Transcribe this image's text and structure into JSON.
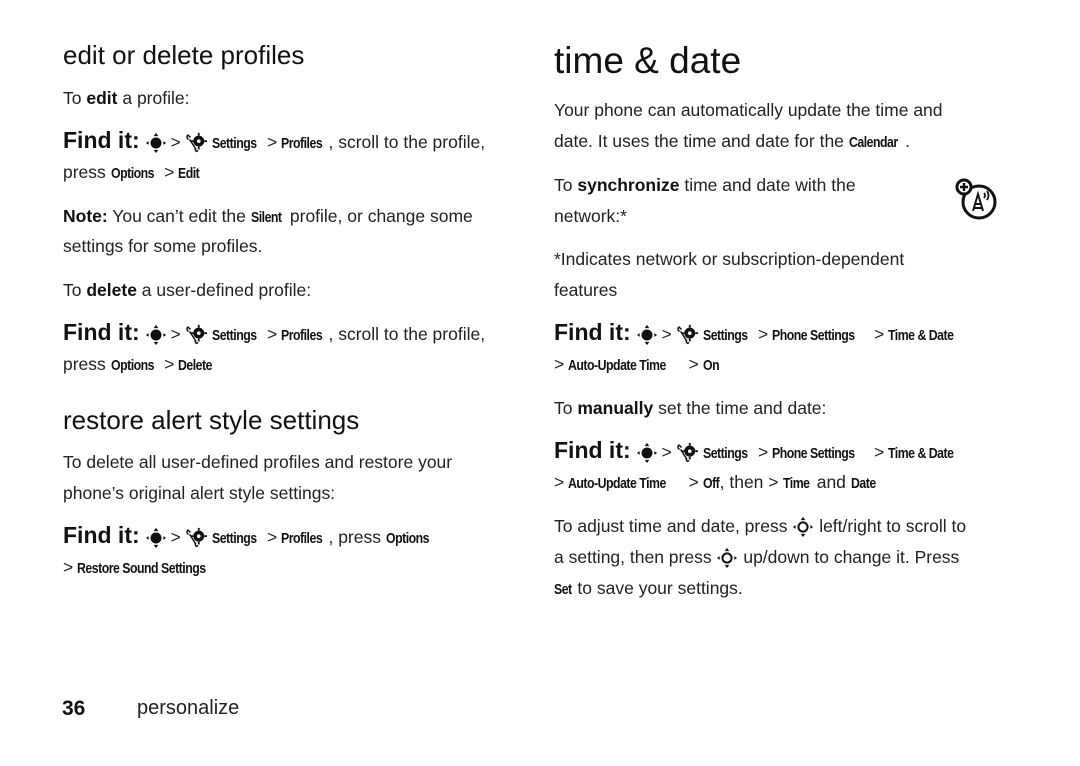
{
  "left": {
    "edit_heading": "edit or delete profiles",
    "edit_intro": {
      "pre": "To ",
      "bold": "edit",
      "post": " a profile:"
    },
    "find_label": "Find it:",
    "find_edit": {
      "settings": "Settings",
      "profiles": "Profiles",
      "tail": ", scroll to the profile,",
      "press": "press ",
      "options": "Options",
      "action": "Edit"
    },
    "note": {
      "label": "Note:",
      "text1": " You can’t edit the ",
      "silent": "Silent",
      "text2": " profile, or change some",
      "line2": "settings for some profiles."
    },
    "delete_intro": {
      "pre": "To ",
      "bold": "delete",
      "post": " a user-defined profile:"
    },
    "find_delete": {
      "settings": "Settings",
      "profiles": "Profiles",
      "tail": ", scroll to the profile,",
      "press": "press ",
      "options": "Options",
      "action": "Delete"
    },
    "restore_heading": "restore alert style settings",
    "restore_text_1": "To delete all user-defined profiles and restore your",
    "restore_text_2": "phone’s original alert style settings:",
    "find_restore": {
      "settings": "Settings",
      "profiles": "Profiles",
      "press": ", press ",
      "options": "Options",
      "action": "Restore Sound Settings"
    }
  },
  "right": {
    "heading": "time & date",
    "intro_1": "Your phone can automatically update the time and",
    "intro_2_pre": "date. It uses the time and date for the ",
    "intro_2_calendar": "Calendar",
    "intro_2_post": ".",
    "sync": {
      "pre": "To ",
      "bold": "synchronize",
      "post": " time and date with the",
      "line2": "network:*"
    },
    "footnote_1": "*Indicates network or subscription-dependent",
    "footnote_2": "features",
    "find_label": "Find it:",
    "find_sync": {
      "settings": "Settings",
      "phone_settings": "Phone Settings",
      "time_date": "Time & Date",
      "auto_update": "Auto-Update Time",
      "value": "On"
    },
    "manual": {
      "pre": "To ",
      "bold": "manually",
      "post": " set the time and date:"
    },
    "find_manual": {
      "settings": "Settings",
      "phone_settings": "Phone Settings",
      "time_date": "Time & Date",
      "auto_update": "Auto-Update Time",
      "value": "Off",
      "then": ", then ",
      "time": "Time",
      "and": " and ",
      "date": "Date"
    },
    "adjust_1_pre": "To adjust time and date, press ",
    "adjust_1_post": " left/right to scroll to",
    "adjust_2_pre": "a setting, then press ",
    "adjust_2_post": " up/down to change it. Press",
    "adjust_3_set": "Set",
    "adjust_3_post": " to save your settings.",
    "network_icon": "network-feature-icon"
  },
  "footer": {
    "page_number": "36",
    "section": "personalize"
  },
  "symbols": {
    "gt": ">"
  }
}
